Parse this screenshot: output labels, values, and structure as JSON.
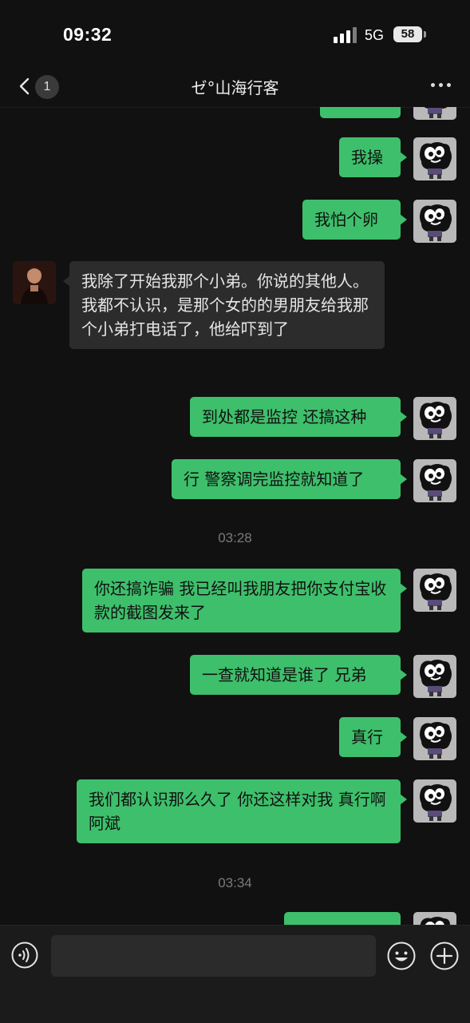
{
  "status_bar": {
    "time": "09:32",
    "network": "5G",
    "battery": "58"
  },
  "nav": {
    "unread_count": "1",
    "title": "ゼ°山海行客"
  },
  "messages": {
    "m0": {
      "text": ""
    },
    "m1": {
      "text": "我操"
    },
    "m2": {
      "text": "我怕个卵"
    },
    "m3": {
      "text": "我除了开始我那个小弟。你说的其他人。我都不认识，是那个女的的男朋友给我那个小弟打电话了，他给吓到了"
    },
    "m4": {
      "text": "到处都是监控 还搞这种"
    },
    "m5": {
      "text": "行 警察调完监控就知道了"
    },
    "ts1": "03:28",
    "m6": {
      "text": "你还搞诈骗 我已经叫我朋友把你支付宝收款的截图发来了"
    },
    "m7": {
      "text": "一查就知道是谁了 兄弟"
    },
    "m8": {
      "text": "真行"
    },
    "m9": {
      "text": "我们都认识那么久了 你还这样对我 真行啊 阿斌"
    },
    "ts2": "03:34",
    "m10": {
      "text": ""
    }
  },
  "input": {
    "placeholder": ""
  },
  "colors": {
    "background": "#111111",
    "outgoing_bubble": "#3ebf6b",
    "incoming_bubble": "#2c2c2c",
    "timestamp": "#7a7a7a"
  },
  "icons": [
    "back-chevron-icon",
    "more-icon",
    "voice-icon",
    "emoji-icon",
    "plus-icon",
    "spongebob-avatar",
    "contact-avatar"
  ]
}
